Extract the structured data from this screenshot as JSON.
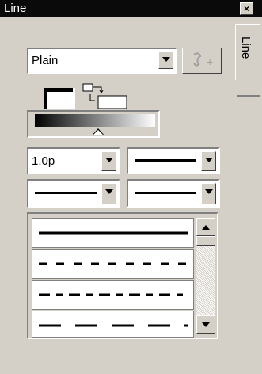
{
  "window": {
    "title": "Line",
    "close_glyph": "×",
    "tab_label": "Line"
  },
  "linestyle": {
    "selected": "Plain",
    "add_button_icon": "add-style-icon"
  },
  "weight": {
    "value": "1.0p"
  },
  "colors": {
    "panel": "#d4d0c8",
    "titlebar": "#0a0a0a"
  }
}
